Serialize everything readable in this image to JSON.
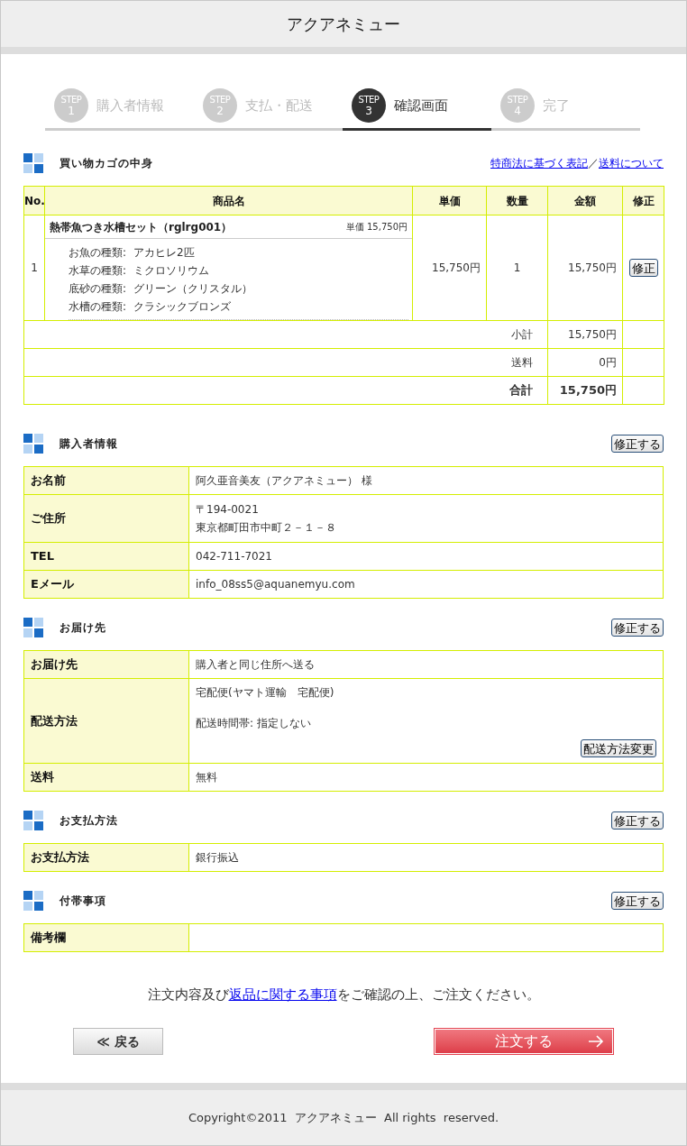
{
  "header": {
    "title": "アクアネミュー"
  },
  "steps": [
    {
      "badge": "STEP",
      "number": "1",
      "label": "購入者情報",
      "selected": false
    },
    {
      "badge": "STEP",
      "number": "2",
      "label": "支払・配送",
      "selected": false
    },
    {
      "badge": "STEP",
      "number": "3",
      "label": "確認画面",
      "selected": true
    },
    {
      "badge": "STEP",
      "number": "4",
      "label": "完了",
      "selected": false
    }
  ],
  "cart": {
    "title": "買い物カゴの中身",
    "links": [
      "特商法に基づく表記",
      "送料について"
    ],
    "separator": "／",
    "columns": [
      "No.",
      "商品名",
      "単価",
      "数量",
      "金額",
      "修正"
    ],
    "items": [
      {
        "no": "1",
        "name": "熱帯魚つき水槽セット（rglrg001）",
        "unit_price_note": "単価 15,750円",
        "options": [
          {
            "label": "お魚の種類:",
            "value": "アカヒレ2匹"
          },
          {
            "label": "水草の種類:",
            "value": "ミクロソリウム"
          },
          {
            "label": "底砂の種類:",
            "value": "グリーン（クリスタル）"
          },
          {
            "label": "水槽の種類:",
            "value": "クラシックブロンズ"
          }
        ],
        "unit_price": "15,750円",
        "quantity": "1",
        "amount": "15,750円",
        "edit_button": "修正"
      }
    ],
    "totals": [
      {
        "kind": "line",
        "label": "小計",
        "value": "15,750円"
      },
      {
        "kind": "line",
        "label": "送料",
        "value": "0円"
      },
      {
        "kind": "grand",
        "label": "合計",
        "value": "15,750円"
      }
    ]
  },
  "sections": [
    {
      "title": "購入者情報",
      "edit_button": "修正する",
      "rows": [
        {
          "label": "お名前",
          "value": "阿久亜音美友（アクアネミュー） 様"
        },
        {
          "label": "ご住所",
          "lines": [
            "〒194-0021",
            "東京都町田市中町２－１－８"
          ]
        },
        {
          "label": "TEL",
          "value": "042-711-7021"
        },
        {
          "label": "Eメール",
          "value": "info_08ss5@aquanemyu.com"
        }
      ]
    },
    {
      "title": "お届け先",
      "edit_button": "修正する",
      "rows": [
        {
          "label": "お届け先",
          "value": "購入者と同じ住所へ送る"
        },
        {
          "label": "配送方法",
          "paragraphs": [
            "宅配便(ヤマト運輸　宅配便)",
            "配送時間帯: 指定しない"
          ],
          "button": "配送方法変更"
        },
        {
          "label": "送料",
          "value": "無料"
        }
      ]
    },
    {
      "title": "お支払方法",
      "edit_button": "修正する",
      "rows": [
        {
          "label": "お支払方法",
          "value": "銀行振込"
        }
      ]
    },
    {
      "title": "付帯事項",
      "edit_button": "修正する",
      "rows": [
        {
          "label": "備考欄"
        }
      ]
    }
  ],
  "notice": {
    "before": "注文内容及び",
    "link": "返品に関する事項",
    "after": "をご確認の上、ご注文ください。"
  },
  "buttons": {
    "back": "≪ 戻る",
    "order": "注文する"
  },
  "footer": {
    "copyright": "Copyright©2011  アクアネミュー  All rights  reserved."
  }
}
